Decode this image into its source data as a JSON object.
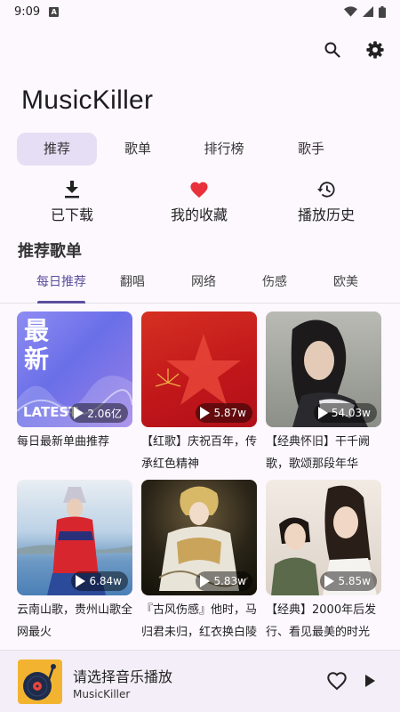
{
  "status": {
    "time": "9:09",
    "notification": "A"
  },
  "header": {
    "app_title": "MusicKiller"
  },
  "main_tabs": [
    {
      "label": "推荐",
      "active": true
    },
    {
      "label": "歌单",
      "active": false
    },
    {
      "label": "排行榜",
      "active": false
    },
    {
      "label": "歌手",
      "active": false
    }
  ],
  "quick_actions": [
    {
      "label": "已下载",
      "icon": "download-icon"
    },
    {
      "label": "我的收藏",
      "icon": "heart-icon"
    },
    {
      "label": "播放历史",
      "icon": "history-icon"
    }
  ],
  "section": {
    "title": "推荐歌单"
  },
  "sub_tabs": [
    {
      "label": "每日推荐",
      "active": true
    },
    {
      "label": "翻唱",
      "active": false
    },
    {
      "label": "网络",
      "active": false
    },
    {
      "label": "伤感",
      "active": false
    },
    {
      "label": "欧美",
      "active": false
    }
  ],
  "playlists": [
    {
      "title": "每日最新单曲推荐",
      "count": "2.06亿",
      "cover_text": "最新",
      "cover_sub": "LATEST"
    },
    {
      "title": "【红歌】庆祝百年，传承红色精神",
      "count": "5.87w"
    },
    {
      "title": "【经典怀旧】干千阙歌，歌颂那段年华",
      "count": "54.03w"
    },
    {
      "title": "云南山歌，贵州山歌全网最火",
      "count": "6.84w"
    },
    {
      "title": "『古风伤感』他时，马归君未归，红衣换白陵",
      "count": "5.83w"
    },
    {
      "title": "【经典】2000年后发行、看见最美的时光",
      "count": "5.85w"
    }
  ],
  "player": {
    "title": "请选择音乐播放",
    "subtitle": "MusicKiller"
  },
  "colors": {
    "accent": "#5c4f9c",
    "tab_active_bg": "#e6def4",
    "heart": "#e8313a"
  }
}
